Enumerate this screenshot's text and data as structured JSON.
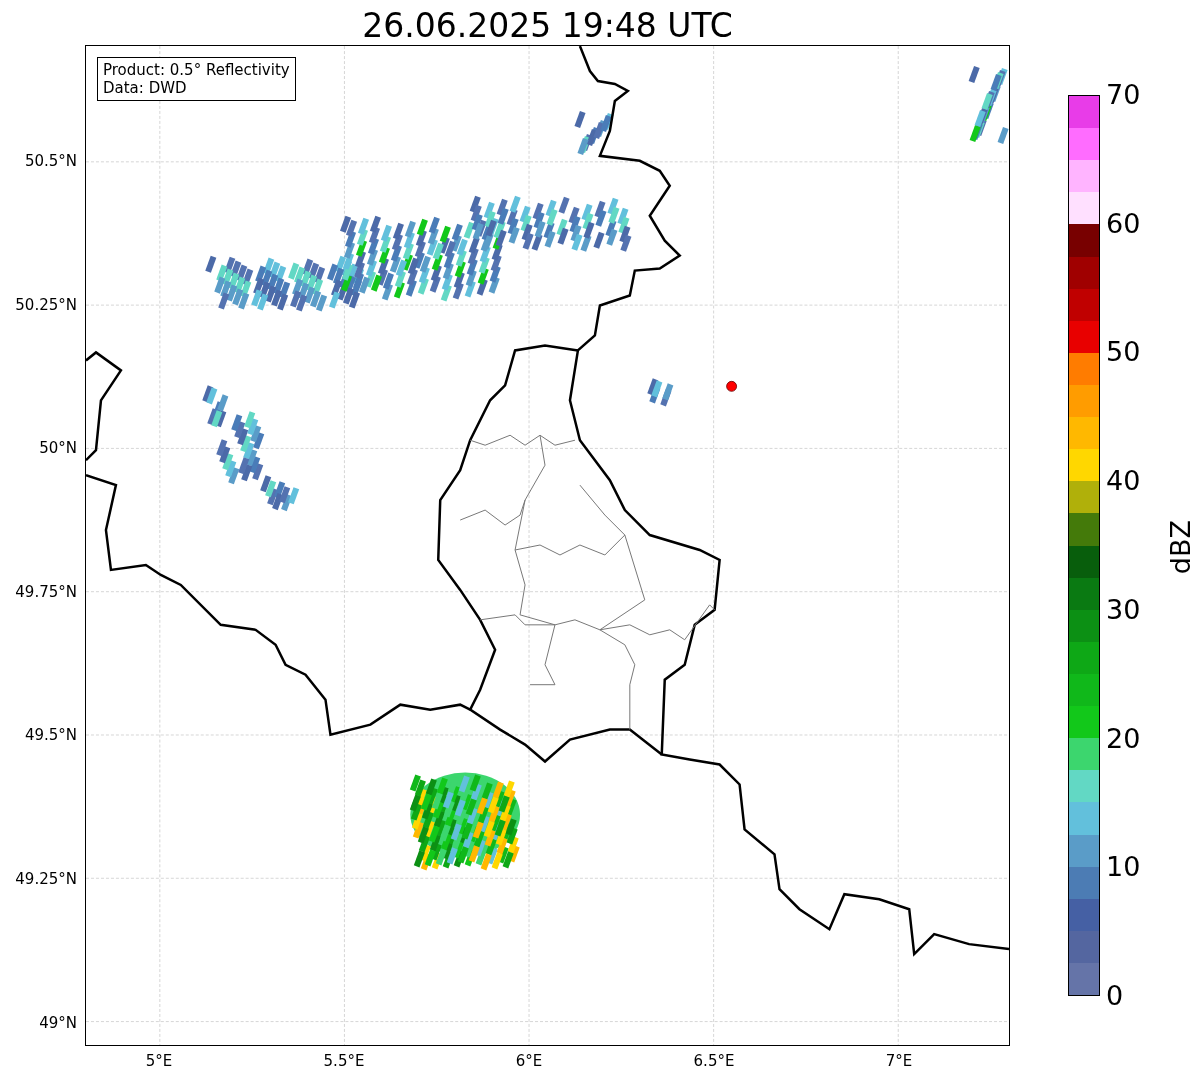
{
  "title": "26.06.2025 19:48 UTC",
  "map": {
    "legend": [
      "Product: 0.5° Reflectivity",
      "Data: DWD"
    ],
    "y_ticks": [
      "50.5°N",
      "50.25°N",
      "50°N",
      "49.75°N",
      "49.5°N",
      "49.25°N",
      "49°N"
    ],
    "x_ticks": [
      "5°E",
      "5.5°E",
      "6°E",
      "6.5°E",
      "7°E"
    ]
  },
  "colorbar": {
    "label": "dBZ",
    "ticks": [
      "70",
      "60",
      "50",
      "40",
      "30",
      "20",
      "10",
      "0"
    ],
    "bands": [
      {
        "color": "#e83ce8"
      },
      {
        "color": "#ff6cff"
      },
      {
        "color": "#ffb4ff"
      },
      {
        "color": "#ffe0ff"
      },
      {
        "color": "#780000"
      },
      {
        "color": "#a00000"
      },
      {
        "color": "#c00000"
      },
      {
        "color": "#e80000"
      },
      {
        "color": "#ff7c00"
      },
      {
        "color": "#ff9c00"
      },
      {
        "color": "#ffb800"
      },
      {
        "color": "#ffd700"
      },
      {
        "color": "#b0b00a"
      },
      {
        "color": "#447a0a"
      },
      {
        "color": "#085e0c"
      },
      {
        "color": "#0a7a12"
      },
      {
        "color": "#0c9014"
      },
      {
        "color": "#0ea816"
      },
      {
        "color": "#10b81a"
      },
      {
        "color": "#12c81a"
      },
      {
        "color": "#3cd66e"
      },
      {
        "color": "#62d8c4"
      },
      {
        "color": "#62c0dc"
      },
      {
        "color": "#5a9cc8"
      },
      {
        "color": "#4c7cb4"
      },
      {
        "color": "#4560a4"
      },
      {
        "color": "#5466a0"
      },
      {
        "color": "#6574a8"
      }
    ]
  }
}
